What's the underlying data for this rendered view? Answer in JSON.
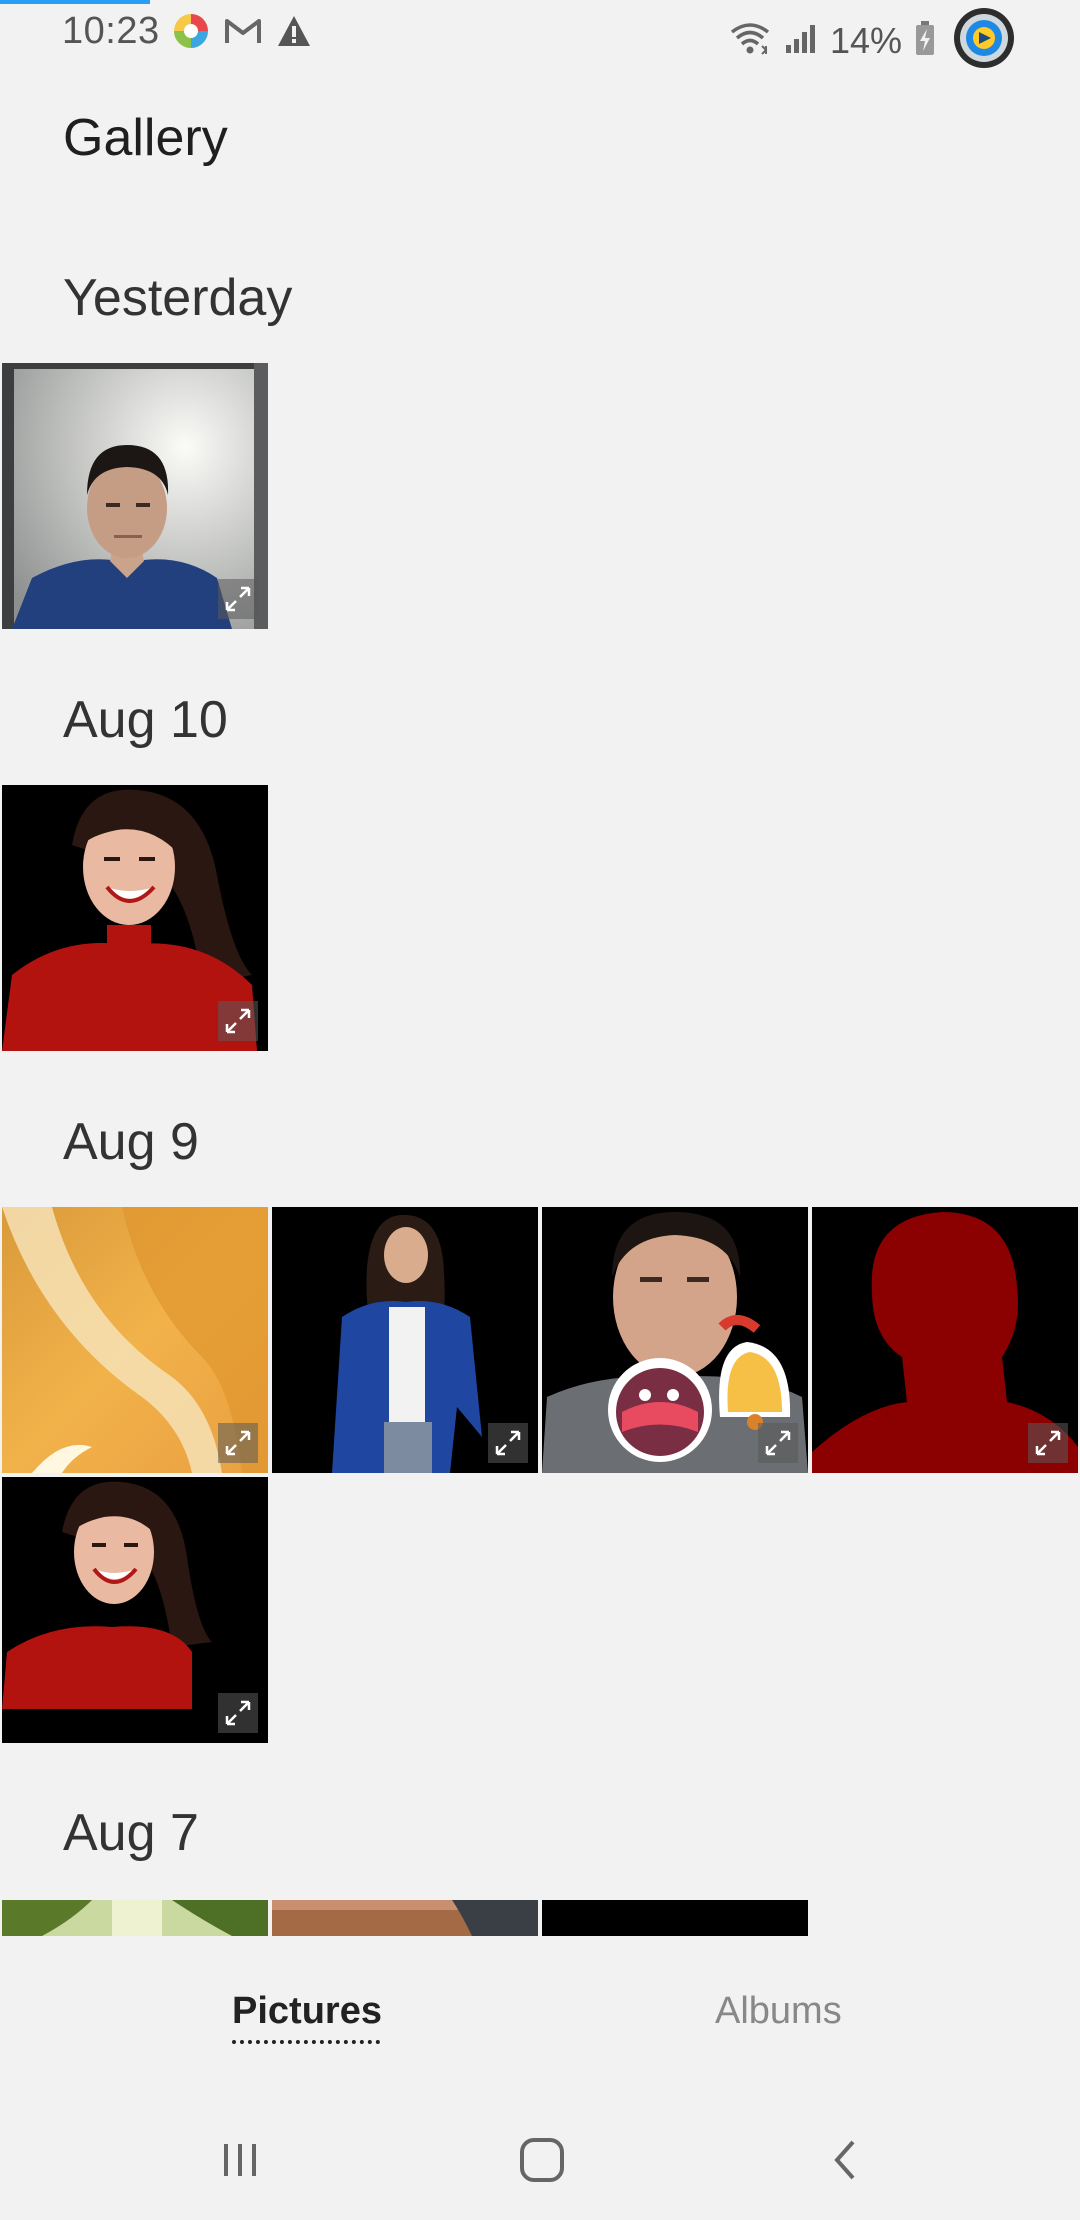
{
  "status_bar": {
    "time": "10:23",
    "battery_percent": "14%",
    "icons_left": [
      "color-wheel-icon",
      "gmail-icon",
      "warning-icon"
    ],
    "icons_right": [
      "wifi-icon",
      "signal-icon",
      "battery-charging-icon",
      "app-bubble-icon"
    ]
  },
  "header": {
    "title": "Gallery"
  },
  "sections": [
    {
      "label": "Yesterday",
      "items": [
        "man-in-blue-shirt-photo"
      ]
    },
    {
      "label": "Aug 10",
      "items": [
        "woman-in-red-photo"
      ]
    },
    {
      "label": "Aug 9",
      "items": [
        "golden-glass-photo",
        "woman-in-blue-jacket-photo",
        "man-with-stickers-photo",
        "red-silhouette-photo",
        "woman-in-red-photo-2"
      ]
    },
    {
      "label": "Aug 7",
      "items": [
        "trees-photo",
        "wood-photo",
        "black-photo"
      ]
    }
  ],
  "tabs": {
    "pictures": "Pictures",
    "albums": "Albums",
    "active": "Pictures"
  },
  "nav": [
    "recents-button",
    "home-button",
    "back-button"
  ],
  "colors": {
    "background": "#f2f2f2",
    "accent": "#2a9df4"
  }
}
